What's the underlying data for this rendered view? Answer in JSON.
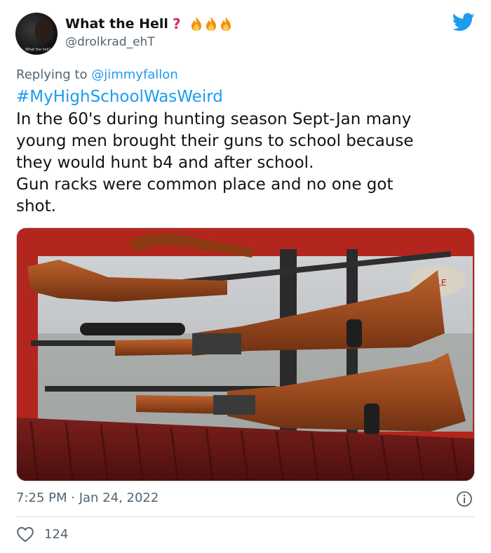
{
  "user": {
    "display_name": "What the Hell",
    "handle": "@drolkrad_ehT",
    "name_emoji": [
      "question-mark",
      "fire",
      "fire",
      "fire"
    ],
    "avatar_caption": "What the hell?"
  },
  "tweet": {
    "replying_prefix": "Replying to",
    "replying_to": "@jimmyfallon",
    "hashtag": "#MyHighSchoolWasWeird",
    "lines": [
      "In the 60's during hunting season Sept-Jan many",
      "young men brought their guns to school because",
      "they would hunt b4 and after school.",
      "Gun racks were common place and no one got",
      "shot."
    ],
    "timestamp": "7:25 PM · Jan 24, 2022",
    "like_count": "124"
  },
  "media": {
    "description_icon": "photo",
    "sign_text": "SALE"
  },
  "colors": {
    "accent": "#1d9bf0",
    "text": "#0f1419",
    "muted": "#536471",
    "question_mark": "#e0245e"
  }
}
